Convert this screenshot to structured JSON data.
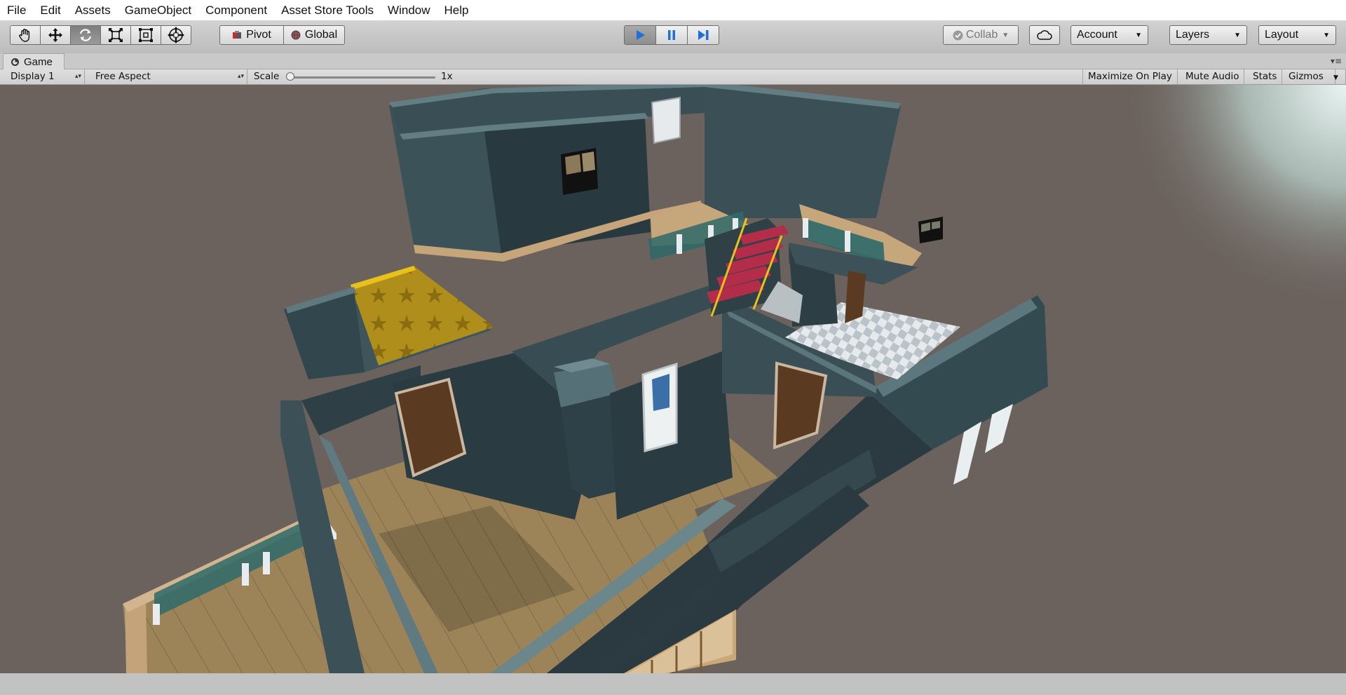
{
  "menu": [
    "File",
    "Edit",
    "Assets",
    "GameObject",
    "Component",
    "Asset Store Tools",
    "Window",
    "Help"
  ],
  "toolbar": {
    "tools": [
      {
        "name": "hand-tool",
        "icon": "hand-icon"
      },
      {
        "name": "move-tool",
        "icon": "move-icon"
      },
      {
        "name": "rotate-tool",
        "icon": "rotate-icon"
      },
      {
        "name": "scale-tool",
        "icon": "scale-icon"
      },
      {
        "name": "rect-tool",
        "icon": "rect-icon"
      },
      {
        "name": "transform-tool",
        "icon": "transform-icon"
      }
    ],
    "pivot_label": "Pivot",
    "global_label": "Global",
    "playback": {
      "play_icon": "play-icon",
      "pause_icon": "pause-icon",
      "step_icon": "step-icon",
      "accent": "#1e6fd9"
    },
    "collab_label": "Collab",
    "cloud_icon": "cloud-icon",
    "account_label": "Account",
    "layers_label": "Layers",
    "layout_label": "Layout"
  },
  "game_tab": {
    "title": "Game",
    "icon": "camera-icon"
  },
  "game_toolbar": {
    "display": "Display 1",
    "aspect": "Free Aspect",
    "scale_label": "Scale",
    "scale_value": "1x",
    "maximize": "Maximize On Play",
    "mute": "Mute Audio",
    "stats": "Stats",
    "gizmos": "Gizmos"
  },
  "viewport": {
    "background": "#6b625d",
    "scene": "3d-house-cutaway"
  }
}
